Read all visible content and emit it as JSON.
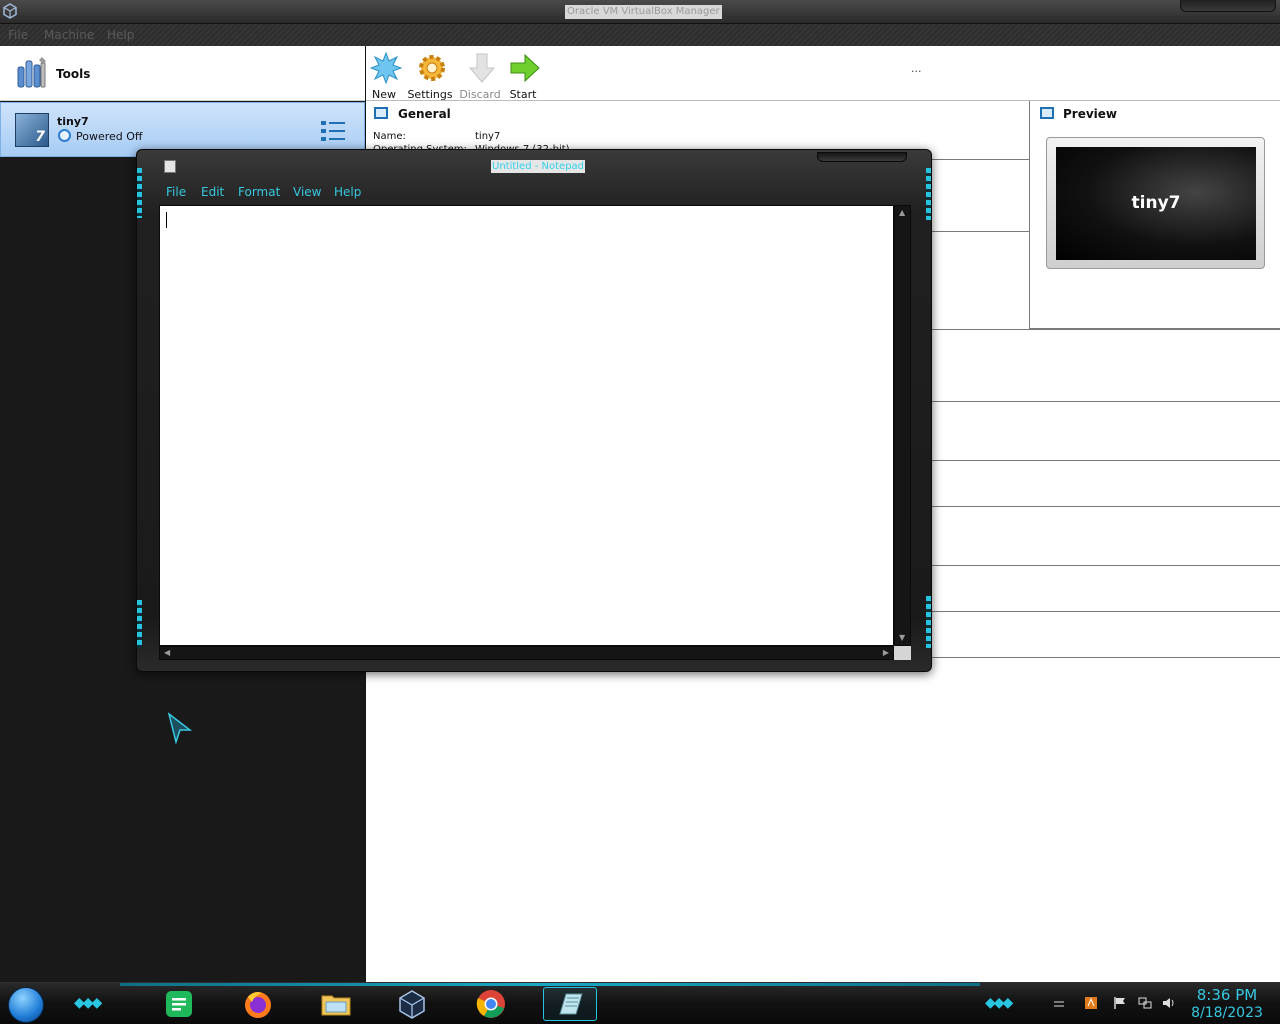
{
  "virtualbox": {
    "window_title": "Oracle VM VirtualBox Manager",
    "menu": [
      "File",
      "Machine",
      "Help"
    ],
    "tools_label": "Tools",
    "vm": {
      "name": "tiny7",
      "state": "Powered Off",
      "os_badge": "7"
    },
    "toolbar": [
      {
        "label": "New",
        "icon": "new-starburst-icon"
      },
      {
        "label": "Settings",
        "icon": "gear-icon"
      },
      {
        "label": "Discard",
        "icon": "down-arrow-icon"
      },
      {
        "label": "Start",
        "icon": "green-arrow-icon"
      }
    ],
    "toolbar_more": "...",
    "details": {
      "general_title": "General",
      "name_key": "Name:",
      "name_value": "tiny7",
      "os_key": "Operating System:",
      "os_value": "Windows 7 (32-bit)"
    },
    "preview": {
      "title": "Preview",
      "screen_label": "tiny7"
    }
  },
  "notepad": {
    "title": "Untitled - Notepad",
    "menu": [
      "File",
      "Edit",
      "Format",
      "View",
      "Help"
    ],
    "text": ""
  },
  "taskbar": {
    "pinned": [
      "start-orb",
      "sheets-icon",
      "firefox-icon",
      "file-explorer-icon",
      "virtualbox-icon",
      "chrome-icon",
      "notepad-icon"
    ],
    "clock_time": "8:36 PM",
    "clock_date": "8/18/2023"
  },
  "colors": {
    "accent": "#35c8e0",
    "selection": "#a7ccf5"
  }
}
